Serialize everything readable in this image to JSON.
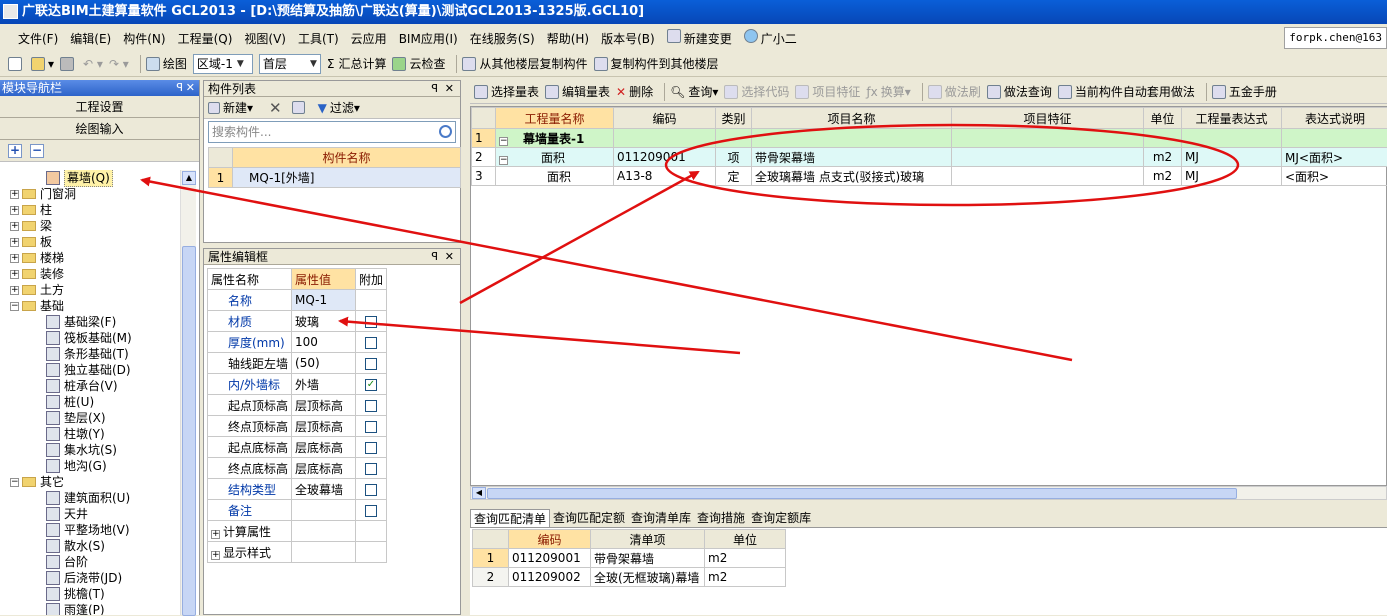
{
  "window": {
    "title": "广联达BIM土建算量软件 GCL2013 - [D:\\预结算及抽筋\\广联达(算量)\\测试GCL2013-1325版.GCL10]"
  },
  "menu": [
    "文件(F)",
    "编辑(E)",
    "构件(N)",
    "工程量(Q)",
    "视图(V)",
    "工具(T)",
    "云应用",
    "BIM应用(I)",
    "在线服务(S)",
    "帮助(H)",
    "版本号(B)",
    "新建变更",
    "广小二"
  ],
  "user": "forpk.chen@163",
  "toolbar": {
    "draw_label": "绘图",
    "area_value": "区域-1",
    "floor_value": "首层",
    "sum_label": "汇总计算",
    "cloud_check_label": "云检查",
    "copy_from_label": "从其他楼层复制构件",
    "copy_to_label": "复制构件到其他楼层"
  },
  "nav": {
    "header": "模块导航栏",
    "btn_project": "工程设置",
    "btn_draw": "绘图输入",
    "tree": [
      {
        "label": "幕墙(Q)",
        "level": 2,
        "selected": true,
        "icon": "curtain-wall-icon"
      },
      {
        "label": "门窗洞",
        "level": 0,
        "folder": true,
        "exp": "+"
      },
      {
        "label": "柱",
        "level": 0,
        "folder": true,
        "exp": "+"
      },
      {
        "label": "梁",
        "level": 0,
        "folder": true,
        "exp": "+"
      },
      {
        "label": "板",
        "level": 0,
        "folder": true,
        "exp": "+"
      },
      {
        "label": "楼梯",
        "level": 0,
        "folder": true,
        "exp": "+"
      },
      {
        "label": "装修",
        "level": 0,
        "folder": true,
        "exp": "+"
      },
      {
        "label": "土方",
        "level": 0,
        "folder": true,
        "exp": "+"
      },
      {
        "label": "基础",
        "level": 0,
        "folder": true,
        "exp": "−"
      },
      {
        "label": "基础梁(F)",
        "level": 2,
        "icon": "foundation-beam-icon"
      },
      {
        "label": "筏板基础(M)",
        "level": 2,
        "icon": "raft-foundation-icon"
      },
      {
        "label": "条形基础(T)",
        "level": 2,
        "icon": "strip-foundation-icon"
      },
      {
        "label": "独立基础(D)",
        "level": 2,
        "icon": "isolated-foundation-icon"
      },
      {
        "label": "桩承台(V)",
        "level": 2,
        "icon": "pile-cap-icon"
      },
      {
        "label": "桩(U)",
        "level": 2,
        "icon": "pile-icon"
      },
      {
        "label": "垫层(X)",
        "level": 2,
        "icon": "cushion-icon"
      },
      {
        "label": "柱墩(Y)",
        "level": 2,
        "icon": "column-pier-icon"
      },
      {
        "label": "集水坑(S)",
        "level": 2,
        "icon": "sump-icon"
      },
      {
        "label": "地沟(G)",
        "level": 2,
        "icon": "trench-icon"
      },
      {
        "label": "其它",
        "level": 0,
        "folder": true,
        "exp": "−"
      },
      {
        "label": "建筑面积(U)",
        "level": 2,
        "icon": "building-area-icon"
      },
      {
        "label": "天井",
        "level": 2,
        "icon": "courtyard-icon"
      },
      {
        "label": "平整场地(V)",
        "level": 2,
        "icon": "site-leveling-icon"
      },
      {
        "label": "散水(S)",
        "level": 2,
        "icon": "apron-icon"
      },
      {
        "label": "台阶",
        "level": 2,
        "icon": "steps-icon"
      },
      {
        "label": "后浇带(JD)",
        "level": 2,
        "icon": "post-pour-strip-icon"
      },
      {
        "label": "挑檐(T)",
        "level": 2,
        "icon": "eave-icon"
      },
      {
        "label": "雨篷(P)",
        "level": 2,
        "icon": "canopy-icon"
      }
    ]
  },
  "component_list": {
    "header": "构件列表",
    "new_label": "新建",
    "filter_label": "过滤",
    "search_placeholder": "搜索构件...",
    "col_name": "构件名称",
    "rows": [
      {
        "num": "1",
        "name": "MQ-1[外墙]"
      }
    ]
  },
  "properties": {
    "header": "属性编辑框",
    "col_name": "属性名称",
    "col_value": "属性值",
    "col_extra": "附加",
    "rows": [
      {
        "name": "名称",
        "value": "MQ-1",
        "blue": true,
        "check": null
      },
      {
        "name": "材质",
        "value": "玻璃",
        "blue": true,
        "check": false
      },
      {
        "name": "厚度(mm)",
        "value": "100",
        "blue": true,
        "check": false
      },
      {
        "name": "轴线距左墙",
        "value": "(50)",
        "blue": false,
        "check": false
      },
      {
        "name": "内/外墙标",
        "value": "外墙",
        "blue": true,
        "check": true
      },
      {
        "name": "起点顶标高",
        "value": "层顶标高",
        "blue": false,
        "check": false
      },
      {
        "name": "终点顶标高",
        "value": "层顶标高",
        "blue": false,
        "check": false
      },
      {
        "name": "起点底标高",
        "value": "层底标高",
        "blue": false,
        "check": false
      },
      {
        "name": "终点底标高",
        "value": "层底标高",
        "blue": false,
        "check": false
      },
      {
        "name": "结构类型",
        "value": "全玻幕墙",
        "blue": true,
        "check": false
      },
      {
        "name": "备注",
        "value": "",
        "blue": true,
        "check": false
      }
    ],
    "groups": [
      "计算属性",
      "显示样式"
    ]
  },
  "qty_toolbar": {
    "select_qty": "选择量表",
    "edit_qty": "编辑量表",
    "delete": "删除",
    "query": "查询",
    "select_code": "选择代码",
    "item_feature": "项目特征",
    "convert": "换算",
    "method_brush": "做法刷",
    "method_query": "做法查询",
    "auto_apply": "当前构件自动套用做法",
    "hardware_manual": "五金手册"
  },
  "qty_table": {
    "headers": [
      "工程量名称",
      "编码",
      "类别",
      "项目名称",
      "项目特征",
      "单位",
      "工程量表达式",
      "表达式说明"
    ],
    "rows": [
      {
        "num": "1",
        "exp": "−",
        "name": "幕墙量表-1",
        "code": "",
        "type": "",
        "item": "",
        "feature": "",
        "unit": "",
        "expr": "",
        "desc": "",
        "group": true
      },
      {
        "num": "2",
        "exp": "−",
        "name": "面积",
        "code": "011209001",
        "type": "项",
        "item": "带骨架幕墙",
        "feature": "",
        "unit": "m2",
        "expr": "MJ",
        "desc": "MJ<面积>",
        "highlight": true
      },
      {
        "num": "3",
        "exp": "",
        "name": "面积",
        "code": "A13-8",
        "type": "定",
        "item": "全玻璃幕墙 点支式(驳接式)玻璃",
        "feature": "",
        "unit": "m2",
        "expr": "MJ",
        "desc": "<面积>"
      }
    ]
  },
  "bottom_tabs": [
    "查询匹配清单",
    "查询匹配定额",
    "查询清单库",
    "查询措施",
    "查询定额库"
  ],
  "match_table": {
    "headers": [
      "编码",
      "清单项",
      "单位"
    ],
    "rows": [
      {
        "num": "1",
        "code": "011209001",
        "item": "带骨架幕墙",
        "unit": "m2"
      },
      {
        "num": "2",
        "code": "011209002",
        "item": "全玻(无框玻璃)幕墙",
        "unit": "m2"
      }
    ]
  },
  "colors": {
    "annotation": "#e01010",
    "title_bg": "#0746b6",
    "header_orange": "#ffe2a3",
    "group_green": "#cff5c8",
    "highlight_cyan": "#def9f7"
  }
}
